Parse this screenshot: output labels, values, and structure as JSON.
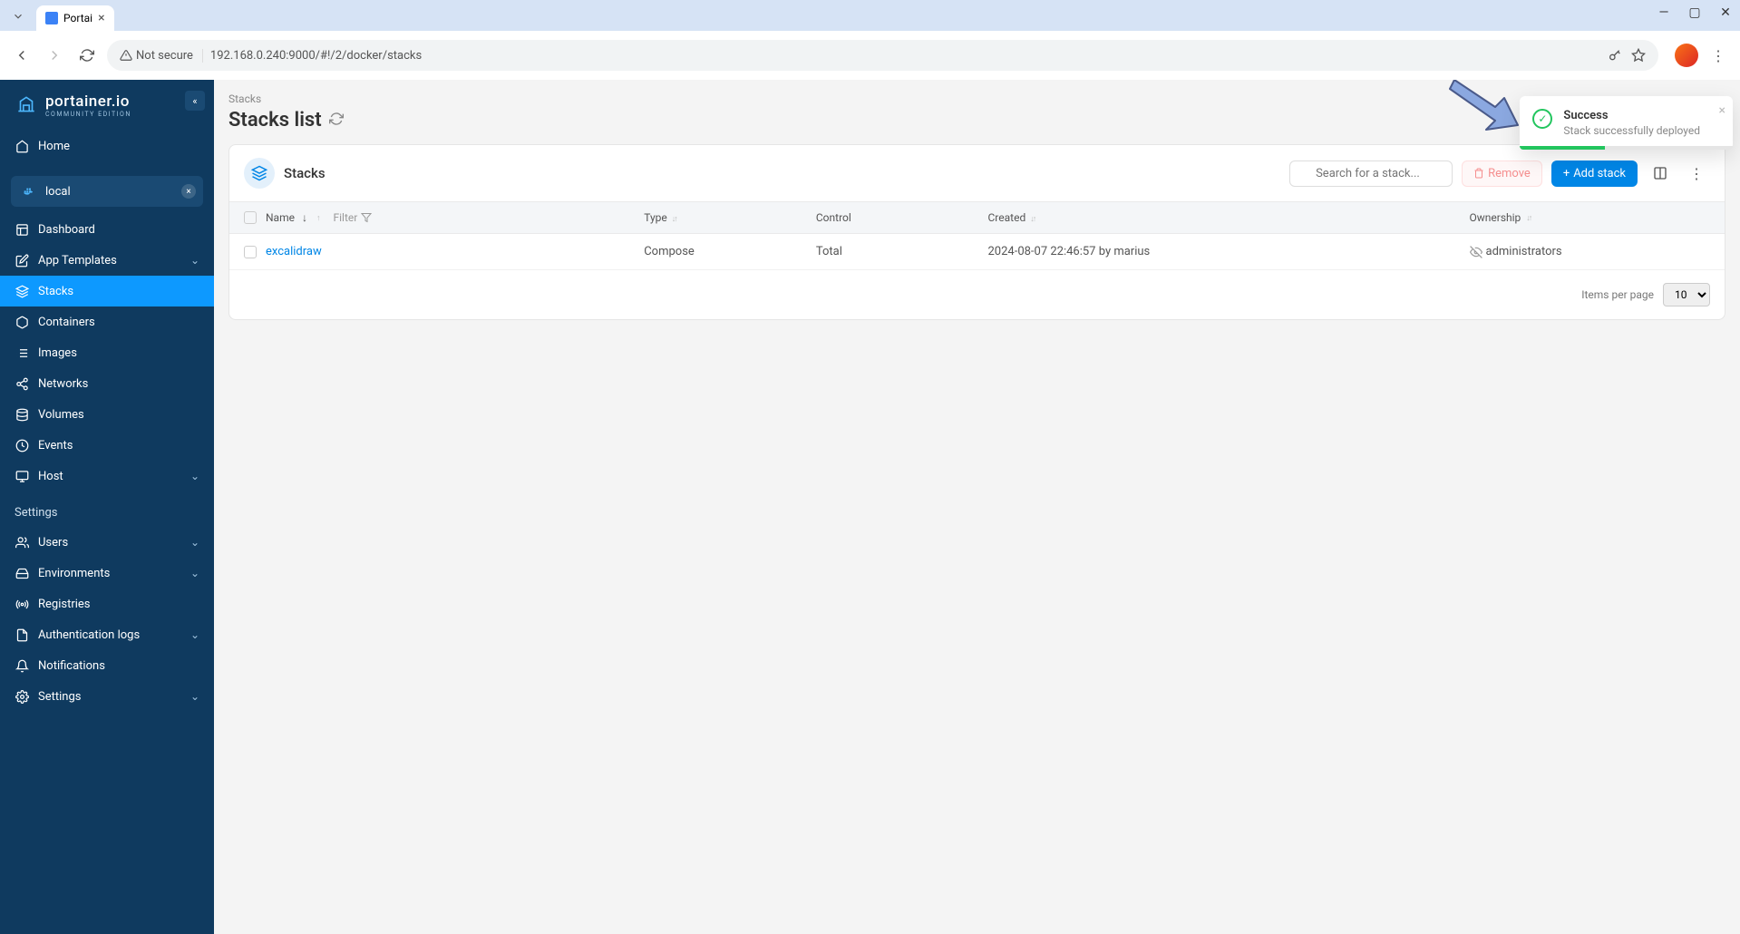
{
  "browser": {
    "tab_title": "Portai",
    "not_secure": "Not secure",
    "url": "192.168.0.240:9000/#!/2/docker/stacks"
  },
  "sidebar": {
    "logo_title": "portainer.io",
    "logo_subtitle": "COMMUNITY EDITION",
    "home": "Home",
    "env_name": "local",
    "items": [
      {
        "label": "Dashboard"
      },
      {
        "label": "App Templates",
        "expandable": true
      },
      {
        "label": "Stacks",
        "active": true
      },
      {
        "label": "Containers"
      },
      {
        "label": "Images"
      },
      {
        "label": "Networks"
      },
      {
        "label": "Volumes"
      },
      {
        "label": "Events"
      },
      {
        "label": "Host",
        "expandable": true
      }
    ],
    "settings_label": "Settings",
    "settings_items": [
      {
        "label": "Users",
        "expandable": true
      },
      {
        "label": "Environments",
        "expandable": true
      },
      {
        "label": "Registries"
      },
      {
        "label": "Authentication logs",
        "expandable": true
      },
      {
        "label": "Notifications"
      },
      {
        "label": "Settings",
        "expandable": true
      }
    ]
  },
  "main": {
    "breadcrumb": "Stacks",
    "title": "Stacks list",
    "panel_title": "Stacks",
    "search_placeholder": "Search for a stack...",
    "remove_label": "Remove",
    "add_label": "Add stack",
    "columns": {
      "name": "Name",
      "filter": "Filter",
      "type": "Type",
      "control": "Control",
      "created": "Created",
      "ownership": "Ownership"
    },
    "rows": [
      {
        "name": "excalidraw",
        "type": "Compose",
        "control": "Total",
        "created": "2024-08-07 22:46:57 by marius",
        "ownership": "administrators"
      }
    ],
    "pagination_label": "Items per page",
    "pagination_value": "10"
  },
  "toast": {
    "title": "Success",
    "message": "Stack successfully deployed"
  }
}
